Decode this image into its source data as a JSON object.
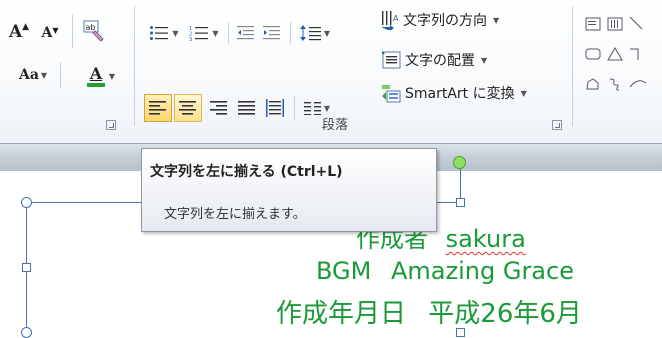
{
  "ribbon": {
    "font_group": {
      "font_size_label": "Aa",
      "font_color_label": "A"
    },
    "paragraph_group": {
      "label": "段落",
      "text_direction": "文字列の方向",
      "align_text": "文字の配置",
      "smartart": "SmartArt に変換"
    },
    "colors": {
      "highlight": "#fbe08c",
      "green_text": "#1a9a38"
    }
  },
  "tooltip": {
    "title": "文字列を左に揃える (Ctrl+L)",
    "description": "文字列を左に揃えます。"
  },
  "slide": {
    "line1_part1": "作成者",
    "line1_part2": "sakura",
    "line2_part1": "BGM",
    "line2_part2": "Amazing Grace",
    "line3_part1": "作成年月日",
    "line3_part2": "平成26年6月"
  }
}
